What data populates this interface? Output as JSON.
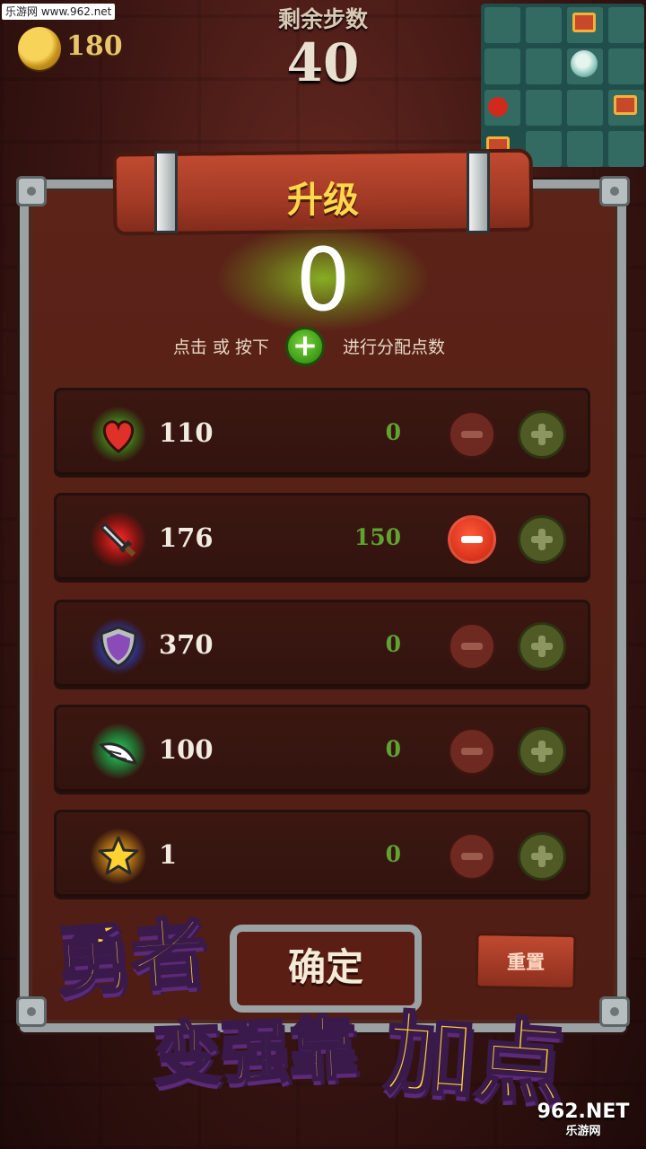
{
  "watermark_top": "乐游网 www.962.net",
  "watermark_bottom": {
    "main": "962.NET",
    "sub": "乐游网"
  },
  "coins": "180",
  "steps": {
    "label": "剩余步数",
    "value": "40"
  },
  "minimap": {
    "colors": {
      "floor": "#336b63",
      "bg": "#204e4a",
      "enemy": "#d12a1c",
      "chest": "#c7482a"
    }
  },
  "panel": {
    "title": "升级",
    "available_points": "0",
    "hint_before": "点击 或 按下",
    "hint_after": "进行分配点数"
  },
  "stats": [
    {
      "name": "health",
      "icon": "heart-icon",
      "value": "110",
      "added": "0",
      "minus_active": false
    },
    {
      "name": "attack",
      "icon": "sword-icon",
      "value": "176",
      "added": "150",
      "minus_active": true
    },
    {
      "name": "defense",
      "icon": "shield-icon",
      "value": "370",
      "added": "0",
      "minus_active": false
    },
    {
      "name": "speed",
      "icon": "wing-icon",
      "value": "100",
      "added": "0",
      "minus_active": false
    },
    {
      "name": "luck",
      "icon": "star-icon",
      "value": "1",
      "added": "0",
      "minus_active": false
    }
  ],
  "buttons": {
    "confirm": "确定",
    "reset": "重置"
  },
  "slogan": {
    "line1": "勇者",
    "line2": "变强靠",
    "line3": "加点"
  },
  "accent_colors": {
    "title_gold": "#ffd84a",
    "delta_green": "#5fa431",
    "minus_red": "#d8321a"
  }
}
